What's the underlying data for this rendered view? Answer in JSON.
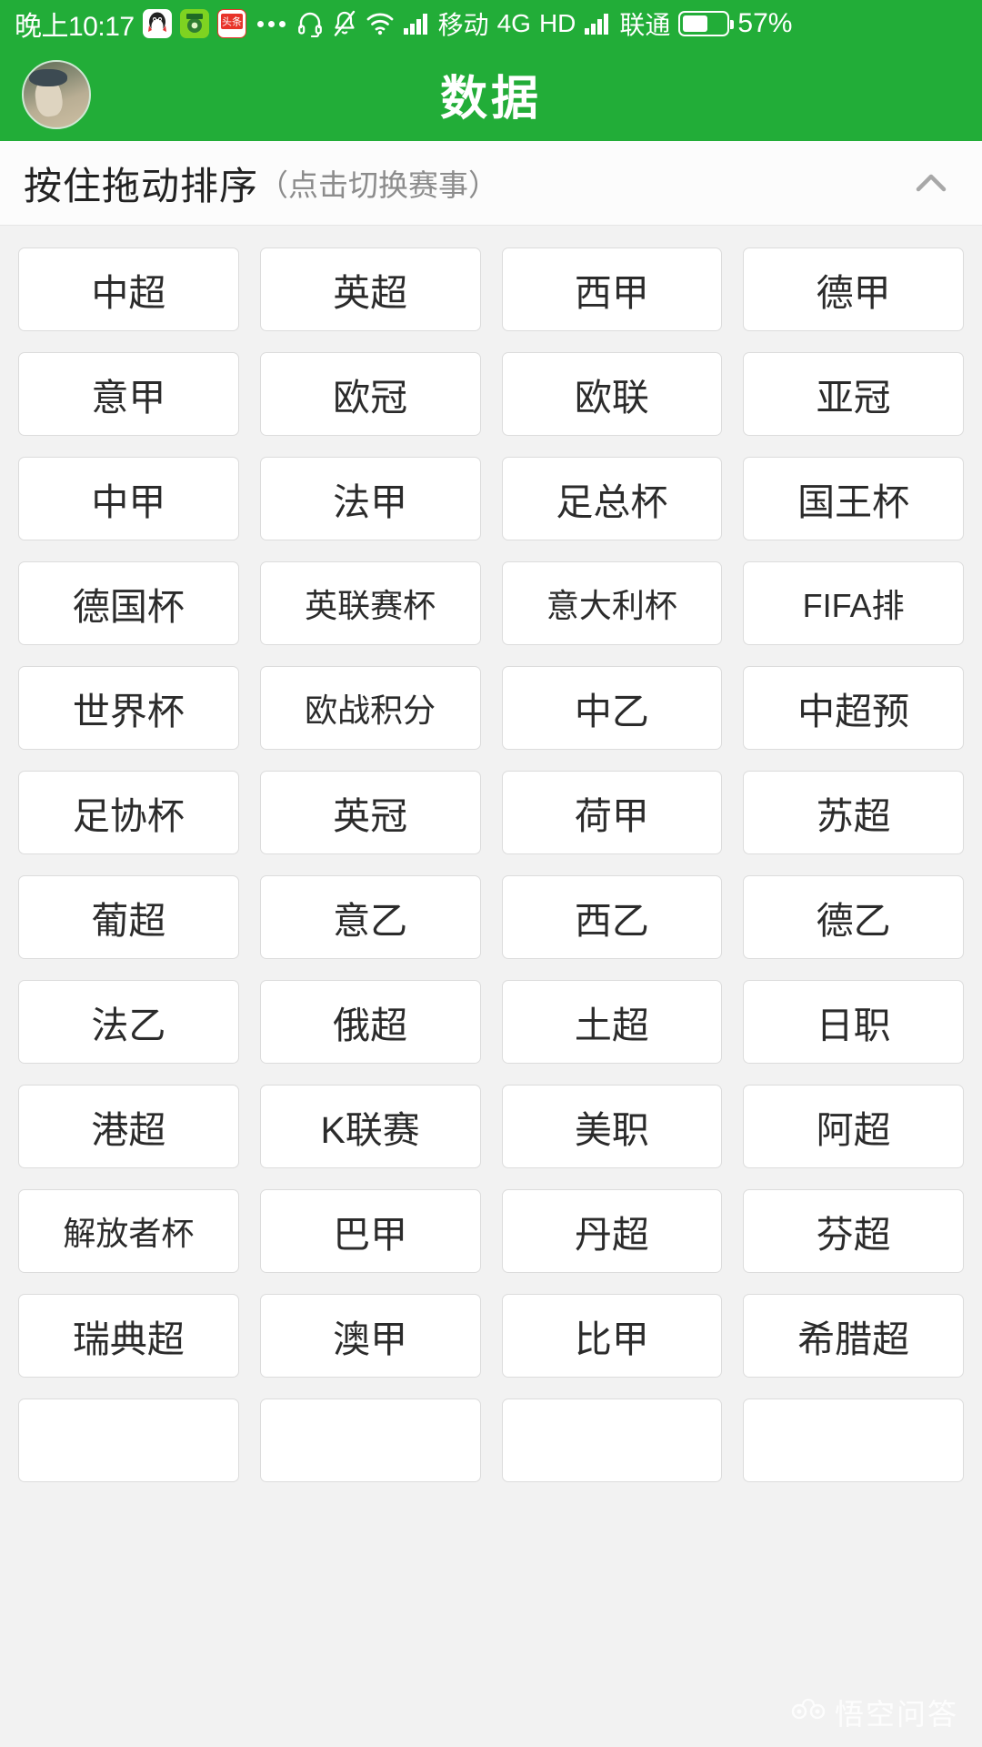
{
  "statusbar": {
    "time": "晚上10:17",
    "app_icons": [
      {
        "name": "qq-icon",
        "glyph": "🐧"
      },
      {
        "name": "green-app-icon",
        "glyph": "⚽"
      },
      {
        "name": "toutiao-icon",
        "glyph": "头条"
      }
    ],
    "more_label": "...",
    "headset_icon": "headset-icon",
    "mute_icon": "bell-muted-icon",
    "wifi_icon": "wifi-icon",
    "signal_icon": "signal-bars-icon",
    "carrier_1": "移动",
    "network": "4G",
    "hd": "HD",
    "carrier_2": "联通",
    "battery_percent": "57%",
    "battery_level": 57
  },
  "titlebar": {
    "title": "数据",
    "avatar_name": "user-avatar"
  },
  "section": {
    "main_label": "按住拖动排序",
    "sub_label": "（点击切换赛事）",
    "collapse_icon": "chevron-up-icon"
  },
  "colors": {
    "brand_green": "#22ad38",
    "page_bg": "#f2f2f2",
    "cell_bg": "#ffffff",
    "cell_border": "#dcdcdc",
    "text": "#2b2b2b",
    "sub_text": "#8c8c8c"
  },
  "grid": {
    "columns": 4,
    "items": [
      "中超",
      "英超",
      "西甲",
      "德甲",
      "意甲",
      "欧冠",
      "欧联",
      "亚冠",
      "中甲",
      "法甲",
      "足总杯",
      "国王杯",
      "德国杯",
      "英联赛杯",
      "意大利杯",
      "FIFA排",
      "世界杯",
      "欧战积分",
      "中乙",
      "中超预",
      "足协杯",
      "英冠",
      "荷甲",
      "苏超",
      "葡超",
      "意乙",
      "西乙",
      "德乙",
      "法乙",
      "俄超",
      "土超",
      "日职",
      "港超",
      "K联赛",
      "美职",
      "阿超",
      "解放者杯",
      "巴甲",
      "丹超",
      "芬超",
      "瑞典超",
      "澳甲",
      "比甲",
      "希腊超",
      "",
      "",
      "",
      ""
    ]
  },
  "watermark": {
    "text": "悟空问答"
  }
}
